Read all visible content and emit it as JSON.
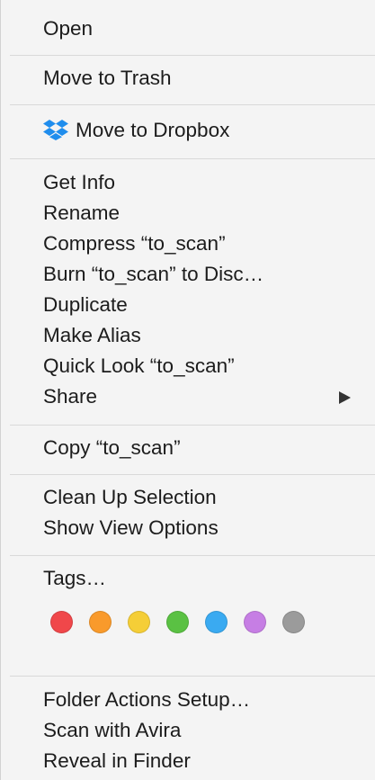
{
  "menu": {
    "open": "Open",
    "move_to_trash": "Move to Trash",
    "move_to_dropbox": "Move to Dropbox",
    "dropbox_icon": "dropbox-icon",
    "get_info": "Get Info",
    "rename": "Rename",
    "compress": "Compress “to_scan”",
    "burn": "Burn “to_scan” to Disc…",
    "duplicate": "Duplicate",
    "make_alias": "Make Alias",
    "quick_look": "Quick Look “to_scan”",
    "share": "Share",
    "share_arrow_icon": "submenu-arrow-icon",
    "copy": "Copy “to_scan”",
    "clean_up_selection": "Clean Up Selection",
    "show_view_options": "Show View Options",
    "tags": "Tags…",
    "tag_colors": [
      {
        "name": "red",
        "color": "#f0474a"
      },
      {
        "name": "orange",
        "color": "#f99a2b"
      },
      {
        "name": "yellow",
        "color": "#f5ce37"
      },
      {
        "name": "green",
        "color": "#5ac143"
      },
      {
        "name": "blue",
        "color": "#3aaaf1"
      },
      {
        "name": "purple",
        "color": "#c67ee4"
      },
      {
        "name": "gray",
        "color": "#9b9b9b"
      }
    ],
    "folder_actions_setup": "Folder Actions Setup…",
    "scan_with_avira": "Scan with Avira",
    "reveal_in_finder": "Reveal in Finder"
  }
}
